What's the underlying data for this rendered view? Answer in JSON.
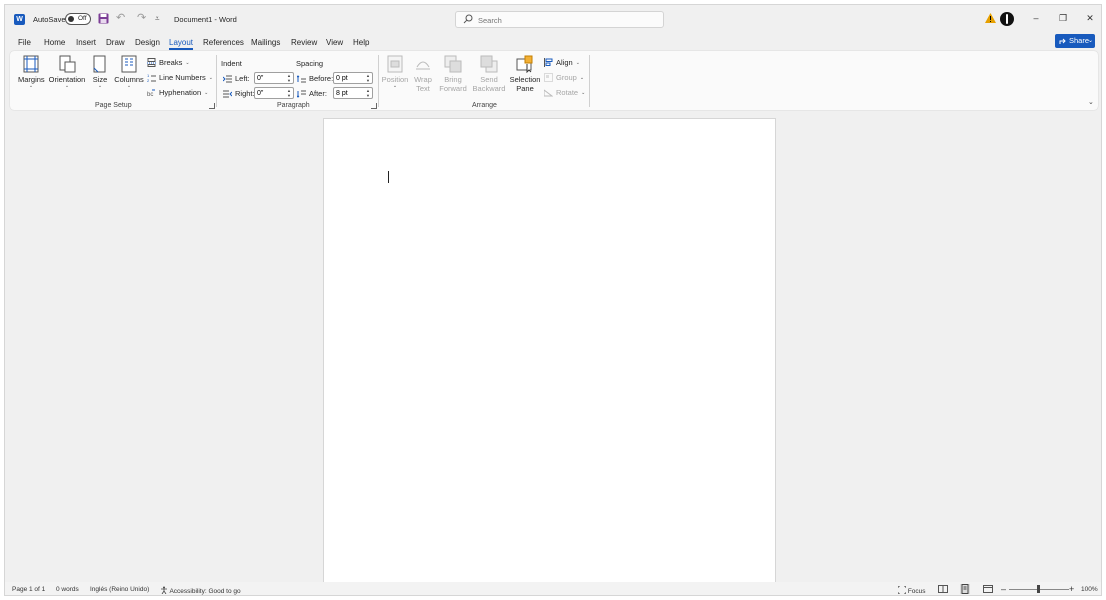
{
  "titlebar": {
    "autosave_label": "AutoSave",
    "autosave_state": "Off",
    "document_title": "Document1  -  Word",
    "search_placeholder": "Search",
    "controls": {
      "minimize": "–",
      "restore": "❐",
      "close": "✕"
    }
  },
  "tabs": [
    "File",
    "Home",
    "Insert",
    "Draw",
    "Design",
    "Layout",
    "References",
    "Mailings",
    "Review",
    "View",
    "Help"
  ],
  "active_tab": "Layout",
  "share_label": "Share",
  "ribbon": {
    "page_setup": {
      "group_label": "Page Setup",
      "margins": "Margins",
      "orientation": "Orientation",
      "size": "Size",
      "columns": "Columns",
      "breaks": "Breaks",
      "line_numbers": "Line Numbers",
      "hyphenation": "Hyphenation"
    },
    "paragraph": {
      "group_label": "Paragraph",
      "indent_header": "Indent",
      "spacing_header": "Spacing",
      "left_label": "Left:",
      "right_label": "Right:",
      "before_label": "Before:",
      "after_label": "After:",
      "left_value": "0\"",
      "right_value": "0\"",
      "before_value": "0 pt",
      "after_value": "8 pt"
    },
    "arrange": {
      "group_label": "Arrange",
      "position": "Position",
      "wrap_line1": "Wrap",
      "wrap_line2": "Text",
      "bring_line1": "Bring",
      "bring_line2": "Forward",
      "send_line1": "Send",
      "send_line2": "Backward",
      "selection_line1": "Selection",
      "selection_line2": "Pane",
      "align": "Align",
      "group": "Group",
      "rotate": "Rotate"
    }
  },
  "statusbar": {
    "page": "Page 1 of 1",
    "words": "0 words",
    "language": "Inglés (Reino Unido)",
    "accessibility": "Accessibility: Good to go",
    "focus": "Focus",
    "zoom": "100%",
    "zoom_out": "–",
    "zoom_in": "+"
  },
  "colors": {
    "accent": "#185abd",
    "background": "#f0f0f0",
    "page": "#ffffff"
  }
}
